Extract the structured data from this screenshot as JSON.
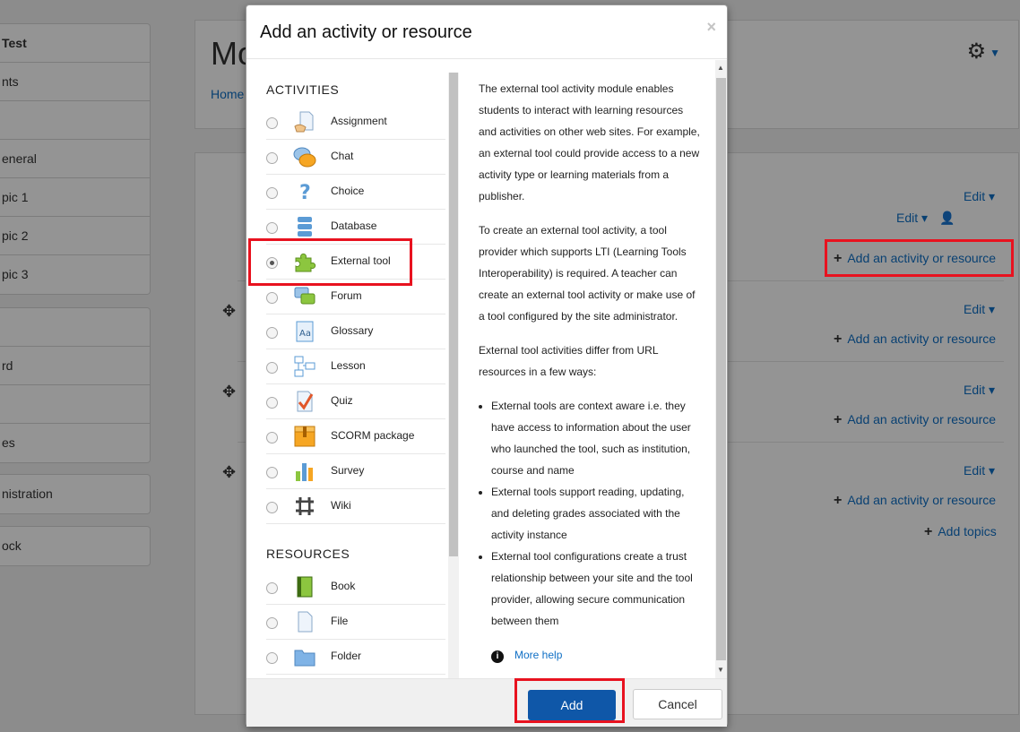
{
  "sidebar": {
    "block1": [
      "Test",
      "nts",
      "",
      "eneral",
      "pic 1",
      "pic 2",
      "pic 3"
    ],
    "block2": [
      "",
      "rd",
      "",
      "es"
    ],
    "block3": [
      "nistration"
    ],
    "block4": [
      "ock"
    ]
  },
  "course": {
    "title": "Mo",
    "breadcrumb": "Home",
    "edit_label": "Edit",
    "add_activity_label": "Add an activity or resource",
    "add_topics_label": "Add topics"
  },
  "modal": {
    "title": "Add an activity or resource",
    "close": "×",
    "activities_heading": "ACTIVITIES",
    "resources_heading": "RESOURCES",
    "activities": [
      {
        "label": "Assignment",
        "icon": "assignment-icon"
      },
      {
        "label": "Chat",
        "icon": "chat-icon"
      },
      {
        "label": "Choice",
        "icon": "choice-icon"
      },
      {
        "label": "Database",
        "icon": "database-icon"
      },
      {
        "label": "External tool",
        "icon": "puzzle-icon",
        "selected": true
      },
      {
        "label": "Forum",
        "icon": "forum-icon"
      },
      {
        "label": "Glossary",
        "icon": "glossary-icon"
      },
      {
        "label": "Lesson",
        "icon": "lesson-icon"
      },
      {
        "label": "Quiz",
        "icon": "quiz-icon"
      },
      {
        "label": "SCORM package",
        "icon": "scorm-icon"
      },
      {
        "label": "Survey",
        "icon": "survey-icon"
      },
      {
        "label": "Wiki",
        "icon": "wiki-icon"
      }
    ],
    "resources": [
      {
        "label": "Book",
        "icon": "book-icon"
      },
      {
        "label": "File",
        "icon": "file-icon"
      },
      {
        "label": "Folder",
        "icon": "folder-icon"
      }
    ],
    "description": {
      "p1": "The external tool activity module enables students to interact with learning resources and activities on other web sites. For example, an external tool could provide access to a new activity type or learning materials from a publisher.",
      "p2": "To create an external tool activity, a tool provider which supports LTI (Learning Tools Interoperability) is required. A teacher can create an external tool activity or make use of a tool configured by the site administrator.",
      "p3": "External tool activities differ from URL resources in a few ways:",
      "bullets": [
        "External tools are context aware i.e. they have access to information about the user who launched the tool, such as institution, course and name",
        "External tools support reading, updating, and deleting grades associated with the activity instance",
        "External tool configurations create a trust relationship between your site and the tool provider, allowing secure communication between them"
      ],
      "more_help": "More help"
    },
    "add_button": "Add",
    "cancel_button": "Cancel"
  },
  "colors": {
    "link": "#0f6fc5",
    "primary_button": "#0f57a8",
    "highlight": "#e8121f"
  }
}
